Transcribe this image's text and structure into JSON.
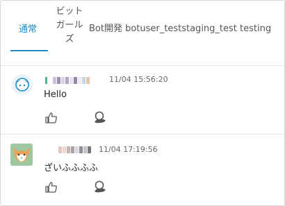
{
  "tabs": [
    {
      "label": "通常",
      "active": true
    },
    {
      "label": "ビット\nガール\nズ",
      "active": false
    },
    {
      "label": "Bot開発 botuser_teststaging_test testing",
      "active": false
    }
  ],
  "posts": [
    {
      "timestamp": "11/04 15:56:20",
      "message": "Hello",
      "avatar_icon": "robot-face-icon"
    },
    {
      "timestamp": "11/04 17:19:56",
      "message": "ざいふふふふ",
      "avatar_icon": "fox-avatar-icon"
    }
  ],
  "colors": {
    "accent": "#1e8bc3",
    "divider": "#e6e6e6"
  }
}
